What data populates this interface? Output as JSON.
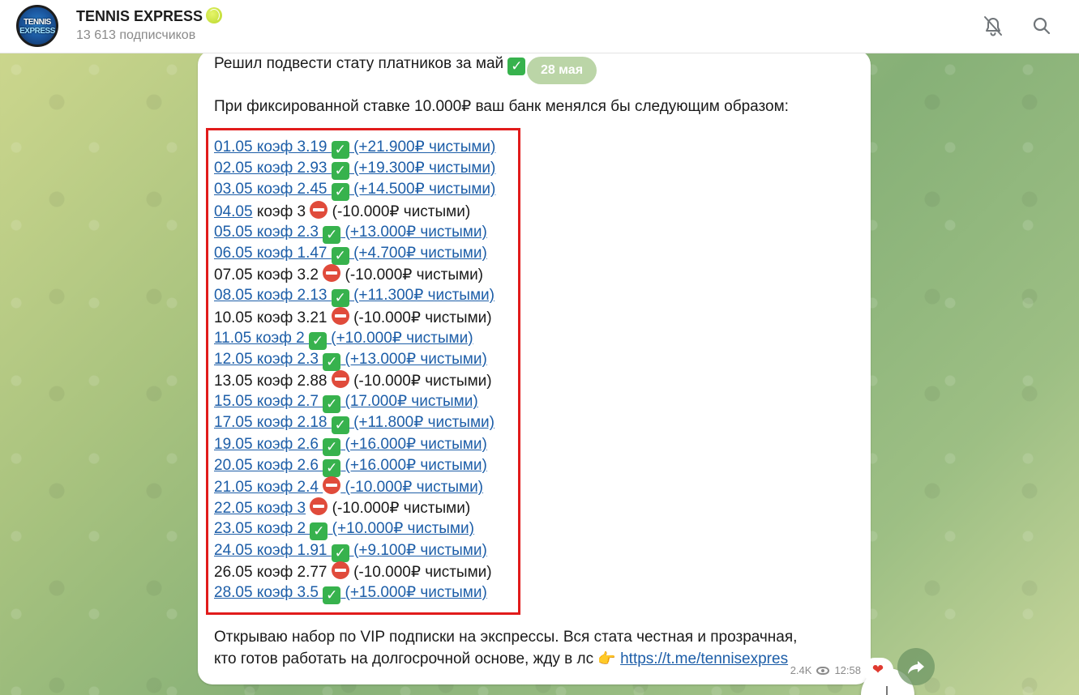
{
  "header": {
    "title": "TENNIS EXPRESS",
    "title_emoji": "tennis-ball",
    "subscribers": "13 613 подписчиков",
    "avatar_line1": "TENNIS",
    "avatar_line2": "EXPRESS",
    "icons": [
      "bell-off-icon",
      "search-icon"
    ]
  },
  "message": {
    "date_pill": "28 мая",
    "intro": "Решил подвести стату платников за май",
    "line2": "При фиксированной ставке 10.000₽ ваш банк менялся бы следующим образом:",
    "rows": [
      {
        "date": "01.05",
        "coef": "коэф 3.19",
        "result": "(+21.900₽ чистыми)",
        "status": "win",
        "link": true
      },
      {
        "date": "02.05",
        "coef": "коэф 2.93",
        "result": "(+19.300₽ чистыми)",
        "status": "win",
        "link": true
      },
      {
        "date": "03.05",
        "coef": "коэф 2.45",
        "result": "(+14.500₽ чистыми)",
        "status": "win",
        "link": true
      },
      {
        "date": "04.05",
        "coef": "коэф 3",
        "result": "(-10.000₽ чистыми)",
        "status": "loss",
        "link": "date-only"
      },
      {
        "date": "05.05",
        "coef": "коэф 2.3",
        "result": "(+13.000₽ чистыми)",
        "status": "win",
        "link": true
      },
      {
        "date": "06.05",
        "coef": "коэф 1.47",
        "result": "(+4.700₽ чистыми)",
        "status": "win",
        "link": true
      },
      {
        "date": "07.05",
        "coef": "коэф 3.2",
        "result": "(-10.000₽ чистыми)",
        "status": "loss",
        "link": false
      },
      {
        "date": "08.05",
        "coef": "коэф 2.13",
        "result": "(+11.300₽ чистыми)",
        "status": "win",
        "link": true
      },
      {
        "date": "10.05",
        "coef": "коэф 3.21",
        "result": "(-10.000₽ чистыми)",
        "status": "loss",
        "link": false
      },
      {
        "date": "11.05",
        "coef": "коэф 2",
        "result": "(+10.000₽ чистыми)",
        "status": "win",
        "link": true
      },
      {
        "date": "12.05",
        "coef": "коэф 2.3",
        "result": "(+13.000₽ чистыми)",
        "status": "win",
        "link": true
      },
      {
        "date": "13.05",
        "coef": "коэф 2.88",
        "result": "(-10.000₽ чистыми)",
        "status": "loss",
        "link": false
      },
      {
        "date": "15.05",
        "coef": "коэф 2.7",
        "result": "(17.000₽ чистыми)",
        "status": "win",
        "link": true
      },
      {
        "date": "17.05",
        "coef": "коэф 2.18",
        "result": "(+11.800₽ чистыми)",
        "status": "win",
        "link": true
      },
      {
        "date": "19.05",
        "coef": "коэф 2.6",
        "result": "(+16.000₽ чистыми)",
        "status": "win",
        "link": true
      },
      {
        "date": "20.05",
        "coef": "коэф 2.6",
        "result": "(+16.000₽ чистыми)",
        "status": "win",
        "link": true
      },
      {
        "date": "21.05",
        "coef": "коэф 2.4",
        "result": "(-10.000₽ чистыми)",
        "status": "loss",
        "link": true
      },
      {
        "date": "22.05",
        "coef": "коэф 3",
        "result": "(-10.000₽ чистыми)",
        "status": "loss",
        "link": "coef"
      },
      {
        "date": "23.05",
        "coef": "коэф 2",
        "result": "(+10.000₽ чистыми)",
        "status": "win",
        "link": true
      },
      {
        "date": "24.05",
        "coef": "коэф 1.91",
        "result": "(+9.100₽ чистыми)",
        "status": "win",
        "link": true
      },
      {
        "date": "26.05",
        "coef": "коэф 2.77",
        "result": "(-10.000₽ чистыми)",
        "status": "loss",
        "link": false
      },
      {
        "date": "28.05",
        "coef": "коэф 3.5",
        "result": "(+15.000₽ чистыми)",
        "status": "win",
        "link": true
      }
    ],
    "outro_line1": "Открываю набор по VIP подписки на экспрессы. Вся стата честная и прозрачная,",
    "outro_line2": "кто готов работать на долгосрочной основе, жду в лс",
    "outro_link": "https://t.me/tennisexpres",
    "views": "2.4K",
    "time": "12:58"
  },
  "colors": {
    "link": "#1d5ea8",
    "highlight_box": "#e11b1b",
    "win": "#37b24d",
    "loss": "#e04b3b"
  }
}
